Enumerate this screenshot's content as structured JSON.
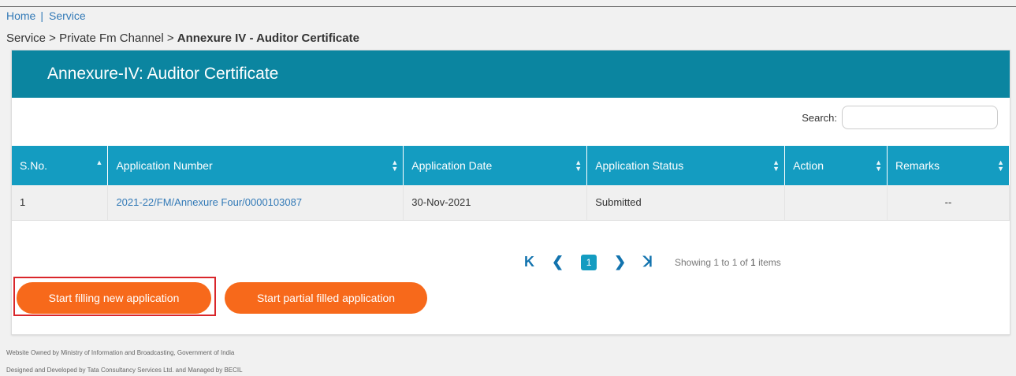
{
  "nav": {
    "home": "Home",
    "service": "Service"
  },
  "breadcrumb": {
    "path": "Service > Private Fm Channel > ",
    "current": "Annexure IV - Auditor Certificate"
  },
  "panel": {
    "title": "Annexure-IV: Auditor Certificate"
  },
  "search": {
    "label": "Search:",
    "value": "",
    "placeholder": ""
  },
  "table": {
    "headers": [
      "S.No.",
      "Application Number",
      "Application Date",
      "Application Status",
      "Action",
      "Remarks"
    ],
    "rows": [
      {
        "sno": "1",
        "number": "2021-22/FM/Annexure Four/0000103087",
        "date": "30-Nov-2021",
        "status": "Submitted",
        "action": "",
        "remarks": "--"
      }
    ]
  },
  "pager": {
    "first": "K",
    "prev": "❮",
    "current": "1",
    "next": "❯",
    "last": "ꓘ",
    "showing_prefix": "Showing 1 to 1 of ",
    "showing_total": "1",
    "showing_suffix": " items"
  },
  "buttons": {
    "new": "Start filling new application",
    "partial": "Start partial filled application"
  },
  "footer": {
    "line1": "Website Owned by Ministry of Information and Broadcasting, Government of India",
    "line2": "Designed and Developed by Tata Consultancy Services Ltd. and Managed by BECIL"
  },
  "colors": {
    "header": "#0b85a0",
    "table_header": "#149cc1",
    "button": "#f7691b",
    "highlight": "#d9262b"
  }
}
